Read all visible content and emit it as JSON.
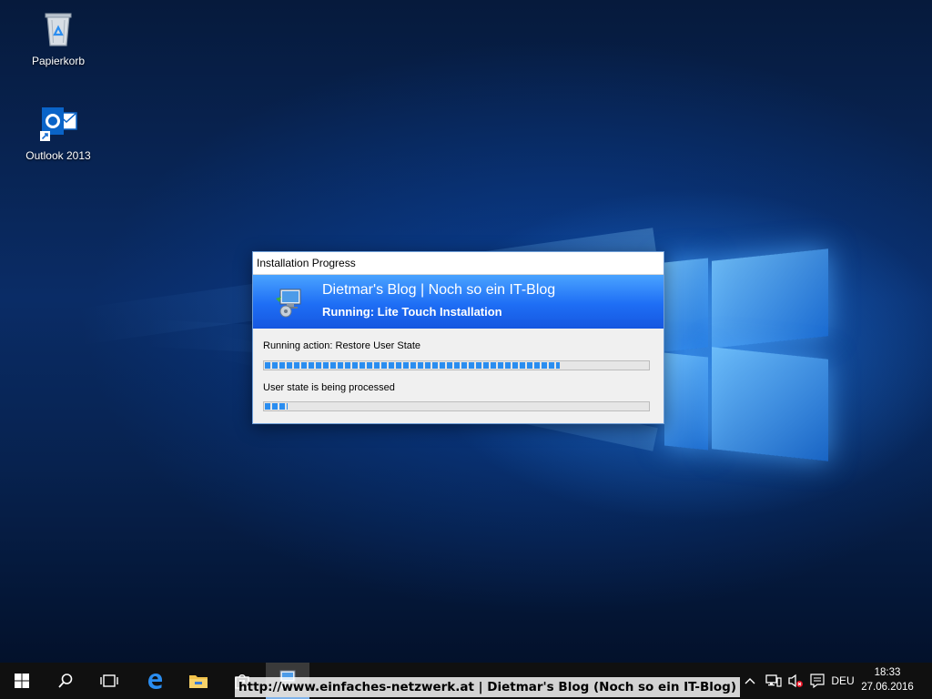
{
  "desktop": {
    "icons": [
      {
        "label": "Papierkorb",
        "icon": "recycle-bin-icon"
      },
      {
        "label": "Outlook 2013",
        "icon": "outlook-icon"
      }
    ]
  },
  "dialog": {
    "title": "Installation Progress",
    "banner_title": "Dietmar's Blog | Noch so ein IT-Blog",
    "banner_subtitle": "Running: Lite Touch Installation",
    "action_label": "Running action: Restore User State",
    "action_progress": 0.77,
    "status_label": "User state is being processed",
    "status_progress": 0.06
  },
  "taskbar": {
    "watermark": "http://www.einfaches-netzwerk.at | Dietmar's Blog (Noch so ein IT-Blog)",
    "language": "DEU",
    "time": "18:33",
    "date": "27.06.2016"
  },
  "colors": {
    "accent": "#1e6ef5",
    "progress": "#2a8df0",
    "taskbar": "#101010"
  }
}
